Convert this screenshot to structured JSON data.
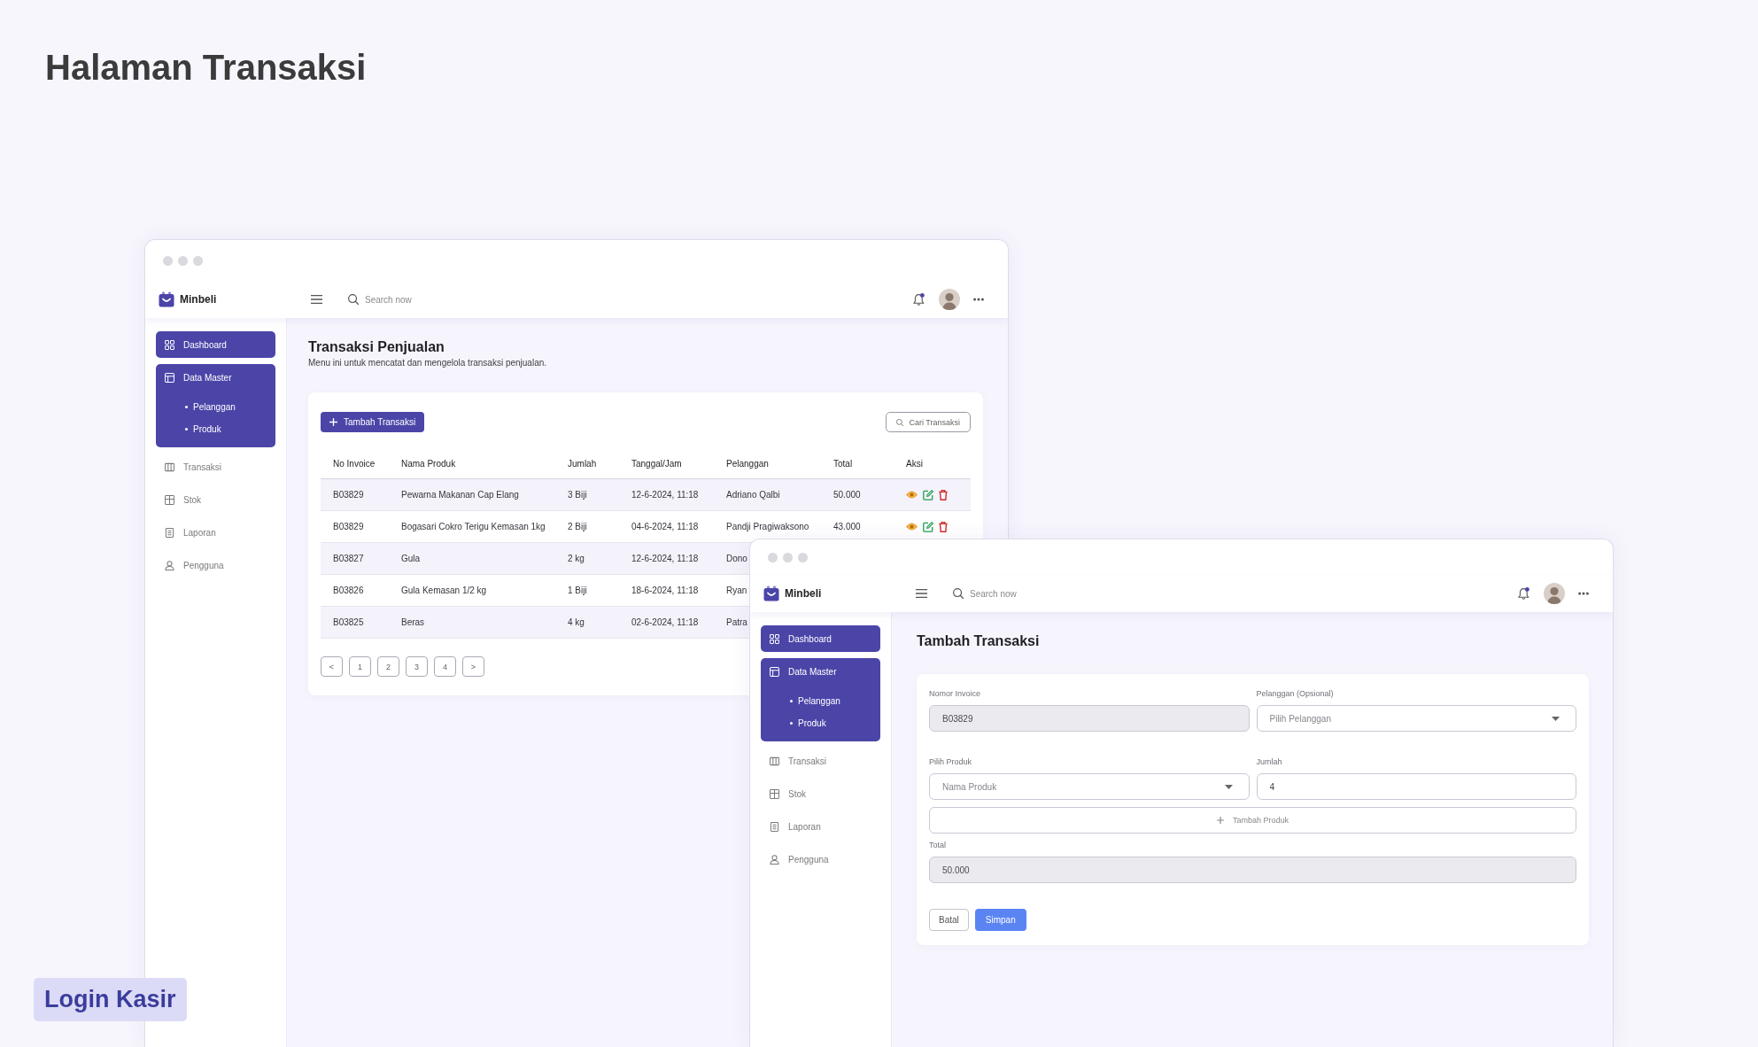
{
  "page_title": "Halaman Transaksi",
  "windows": [
    {
      "kind": "list",
      "brand": "Minbeli",
      "search": {
        "placeholder": "Search now"
      },
      "sidebar": {
        "items": [
          {
            "label": "Dashboard",
            "selected": true
          },
          {
            "label": "Data Master",
            "selected": true,
            "expanded": true,
            "children": [
              {
                "label": "Pelanggan",
                "selected": false
              },
              {
                "label": "Produk",
                "selected": false
              }
            ]
          },
          {
            "label": "Transaksi",
            "selected": false
          },
          {
            "label": "Stok",
            "selected": false
          },
          {
            "label": "Laporan",
            "selected": false
          },
          {
            "label": "Pengguna",
            "selected": false
          }
        ]
      },
      "main": {
        "title": "Transaksi Penjualan",
        "subtitle": "Menu ini untuk mencatat dan mengelola transaksi penjualan.",
        "add_button": "Tambah Transaksi",
        "search_button": "Cari Transaksi",
        "table": {
          "columns": [
            "No Invoice",
            "Nama Produk",
            "Jumlah",
            "Tanggal/Jam",
            "Pelanggan",
            "Total",
            "Aksi"
          ],
          "rows": [
            {
              "cells": [
                "B03829",
                "Pewarna Makanan Cap Elang",
                "3 Biji",
                "12-6-2024, 11:18",
                "Adriano Qalbi",
                "50.000"
              ],
              "actions": true
            },
            {
              "cells": [
                "B03829",
                "Bogasari Cokro Terigu Kemasan 1kg",
                "2 Biji",
                "04-6-2024, 11:18",
                "Pandji Pragiwaksono",
                "43.000"
              ],
              "actions": true
            },
            {
              "cells": [
                "B03827",
                "Gula",
                "2 kg",
                "12-6-2024, 11:18",
                "Dono"
              ]
            },
            {
              "cells": [
                "B03826",
                "Gula Kemasan 1/2 kg",
                "1 Biji",
                "18-6-2024, 11:18",
                "Ryan"
              ]
            },
            {
              "cells": [
                "B03825",
                "Beras",
                "4 kg",
                "02-6-2024, 11:18",
                "Patra"
              ]
            }
          ]
        },
        "pagination": [
          "<",
          "1",
          "2",
          "3",
          "4",
          ">"
        ]
      }
    },
    {
      "kind": "form",
      "brand": "Minbeli",
      "search": {
        "placeholder": "Search now"
      },
      "sidebar": {
        "items": [
          {
            "label": "Dashboard",
            "selected": true
          },
          {
            "label": "Data Master",
            "selected": true,
            "expanded": true,
            "children": [
              {
                "label": "Pelanggan",
                "selected": false
              },
              {
                "label": "Produk",
                "selected": false
              }
            ]
          },
          {
            "label": "Transaksi",
            "selected": false
          },
          {
            "label": "Stok",
            "selected": false
          },
          {
            "label": "Laporan",
            "selected": false
          },
          {
            "label": "Pengguna",
            "selected": false
          }
        ]
      },
      "main": {
        "title": "Tambah Transaksi",
        "fields": [
          {
            "kind": "input",
            "label": "Nomor Invoice",
            "value": "B03829",
            "disabled": true
          },
          {
            "kind": "select",
            "label": "Pelanggan (Opsional)",
            "placeholder": "Pilih Pelanggan",
            "disabled": false
          },
          {
            "kind": "select",
            "label": "Pilih Produk",
            "placeholder": "Nama Produk",
            "disabled": false
          },
          {
            "kind": "input",
            "label": "Jumlah",
            "value": "4",
            "disabled": false
          }
        ],
        "add_product_button": "Tambah Produk",
        "total": {
          "label": "Total",
          "value": "50.000",
          "disabled": true
        },
        "buttons": [
          {
            "kind": "secondary",
            "label": "Batal"
          },
          {
            "kind": "primary",
            "label": "Simpan"
          }
        ]
      }
    }
  ],
  "tag": "Login Kasir"
}
